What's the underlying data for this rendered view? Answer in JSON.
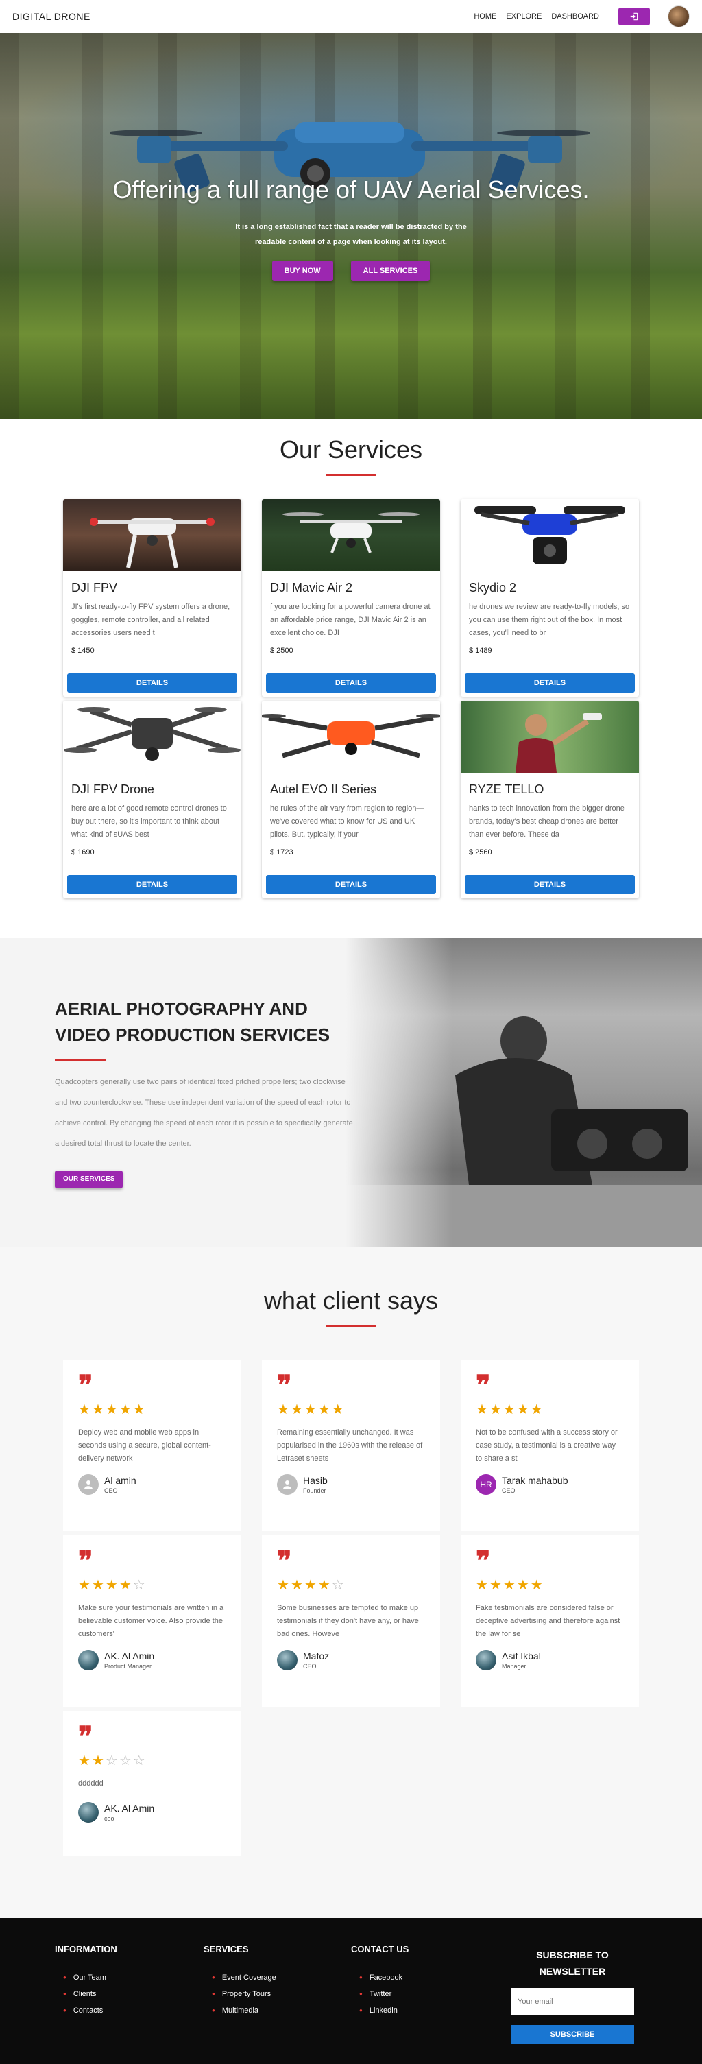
{
  "nav": {
    "brand": "DIGITAL DRONE",
    "links": [
      "HOME",
      "EXPLORE",
      "DASHBOARD"
    ]
  },
  "hero": {
    "title": "Offering a full range of UAV Aerial Services.",
    "subtitle": "It is a long established fact that a reader will be distracted by the readable content of a page when looking at its layout.",
    "buttons": [
      "BUY NOW",
      "ALL SERVICES"
    ]
  },
  "services": {
    "title": "Our Services",
    "button_label": "DETAILS",
    "items": [
      {
        "name": "DJI FPV",
        "desc": "JI's first ready-to-fly FPV system offers a drone, goggles, remote controller, and all related accessories users need t",
        "price": "$ 1450"
      },
      {
        "name": "DJI Mavic Air 2",
        "desc": "f you are looking for a powerful camera drone at an affordable price range, DJI Mavic Air 2 is an excellent choice. DJI",
        "price": "$ 2500"
      },
      {
        "name": "Skydio 2",
        "desc": "he drones we review are ready-to-fly models, so you can use them right out of the box. In most cases, you'll need to br",
        "price": "$ 1489"
      },
      {
        "name": "DJI FPV Drone",
        "desc": "here are a lot of good remote control drones to buy out there, so it's important to think about what kind of sUAS best",
        "price": "$ 1690"
      },
      {
        "name": "Autel EVO II Series",
        "desc": "he rules of the air vary from region to region—we've covered what to know for US and UK pilots. But, typically, if your",
        "price": "$ 1723"
      },
      {
        "name": "RYZE TELLO",
        "desc": "hanks to tech innovation from the bigger drone brands, today's best cheap drones are better than ever before. These da",
        "price": "$ 2560"
      }
    ]
  },
  "about": {
    "title": "AERIAL PHOTOGRAPHY AND VIDEO PRODUCTION SERVICES",
    "desc": "Quadcopters generally use two pairs of identical fixed pitched propellers; two clockwise and two counterclockwise. These use independent variation of the speed of each rotor to achieve control. By changing the speed of each rotor it is possible to specifically generate a desired total thrust to locate the center.",
    "button": "OUR SERVICES"
  },
  "testimonials": {
    "title": "what client says",
    "quote_mark": "❞",
    "items": [
      {
        "quote": "Deploy web and mobile web apps in seconds using a secure, global content-delivery network",
        "name": "Al amin",
        "role": "CEO",
        "rating": 5,
        "avatar": "grey",
        "initials": ""
      },
      {
        "quote": "Remaining essentially unchanged. It was popularised in the 1960s with the release of Letraset sheets",
        "name": "Hasib",
        "role": "Founder",
        "rating": 5,
        "avatar": "grey",
        "initials": ""
      },
      {
        "quote": "Not to be confused with a success story or case study, a testimonial is a creative way to share a st",
        "name": "Tarak mahabub",
        "role": "CEO",
        "rating": 5,
        "avatar": "purple",
        "initials": "HR"
      },
      {
        "quote": "Make sure your testimonials are written in a believable customer voice. Also provide the customers'",
        "name": "AK. Al Amin",
        "role": "Product Manager",
        "rating": 4,
        "avatar": "photo",
        "initials": ""
      },
      {
        "quote": "Some businesses are tempted to make up testimonials if they don't have any, or have bad ones. Howeve",
        "name": "Mafoz",
        "role": "CEO",
        "rating": 4,
        "avatar": "photo",
        "initials": ""
      },
      {
        "quote": "Fake testimonials are considered false or deceptive advertising and therefore against the law for se",
        "name": "Asif Ikbal",
        "role": "Manager",
        "rating": 5,
        "avatar": "photo",
        "initials": ""
      },
      {
        "quote": "dddddd",
        "name": "AK. Al Amin",
        "role": "ceo",
        "rating": 2,
        "avatar": "photo",
        "initials": ""
      }
    ]
  },
  "footer": {
    "information": {
      "title": "INFORMATION",
      "items": [
        "Our Team",
        "Clients",
        "Contacts"
      ]
    },
    "services": {
      "title": "SERVICES",
      "items": [
        "Event Coverage",
        "Property Tours",
        "Multimedia"
      ]
    },
    "contact": {
      "title": "CONTACT US",
      "items": [
        "Facebook",
        "Twitter",
        "Linkedin"
      ]
    },
    "subscribe": {
      "title": "SUBSCRIBE TO NEWSLETTER",
      "placeholder": "Your email",
      "button": "SUBSCRIBE"
    }
  },
  "colors": {
    "accent_purple": "#9c27b0",
    "accent_blue": "#1976d2",
    "accent_red": "#d32f2f",
    "star": "#f0a500"
  }
}
